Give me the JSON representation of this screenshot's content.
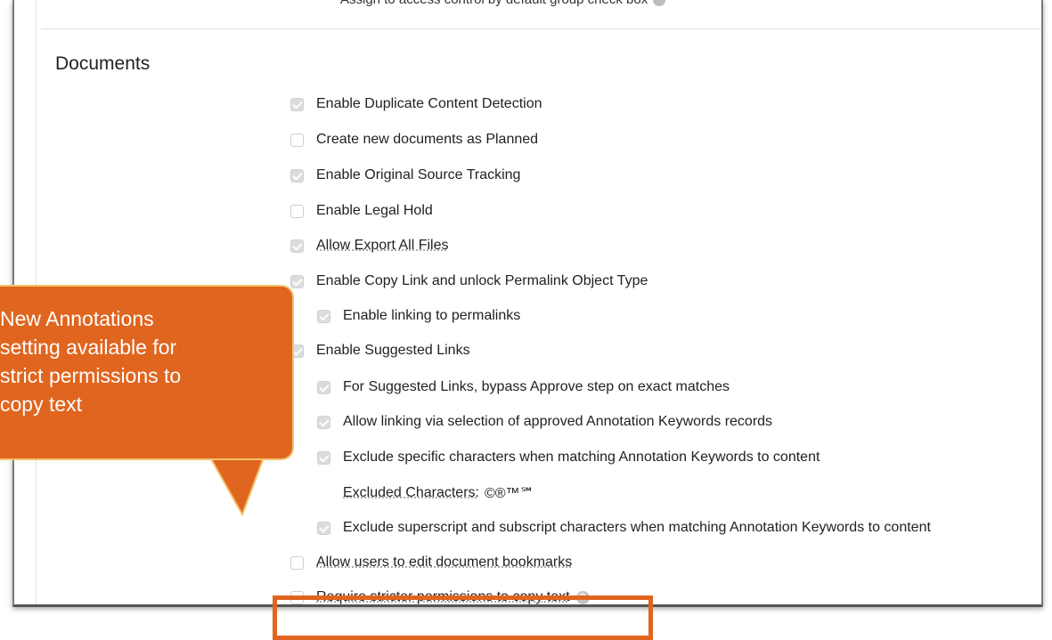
{
  "top_cut_text": "Assign to access control by default group check box",
  "section": {
    "title": "Documents"
  },
  "options": [
    {
      "label": "Enable Duplicate Content Detection",
      "checked": true
    },
    {
      "label": "Create new documents as Planned",
      "checked": false
    },
    {
      "label": "Enable Original Source Tracking",
      "checked": true
    },
    {
      "label": "Enable Legal Hold",
      "checked": false
    },
    {
      "label": "Allow Export All Files",
      "checked": true
    },
    {
      "label": "Enable Copy Link and unlock Permalink Object Type",
      "checked": true
    },
    {
      "label": "Enable linking to permalinks",
      "checked": true
    },
    {
      "label": "Enable Suggested Links",
      "checked": true
    },
    {
      "label": "For Suggested Links, bypass Approve step on exact matches",
      "checked": true
    },
    {
      "label": "Allow linking via selection of approved Annotation Keywords records",
      "checked": true
    },
    {
      "label": "Exclude specific characters when matching Annotation Keywords to content",
      "checked": true
    },
    {
      "label": "Exclude superscript and subscript characters when matching Annotation Keywords to content",
      "checked": true
    },
    {
      "label": "Allow users to edit document bookmarks",
      "checked": false
    },
    {
      "label": "Require stricter permissions to copy text",
      "checked": false
    }
  ],
  "excluded_characters": {
    "label": "Excluded Characters:",
    "value": "©®™℠"
  },
  "help_icon": "question-circle-icon",
  "callout": {
    "text": "New Annotations\nsetting available for\nstrict permissions to\ncopy text"
  },
  "colors": {
    "accent": "#e0651f",
    "callout_border": "#f3c36a",
    "checkbox_checked": "#dcdcdc"
  }
}
